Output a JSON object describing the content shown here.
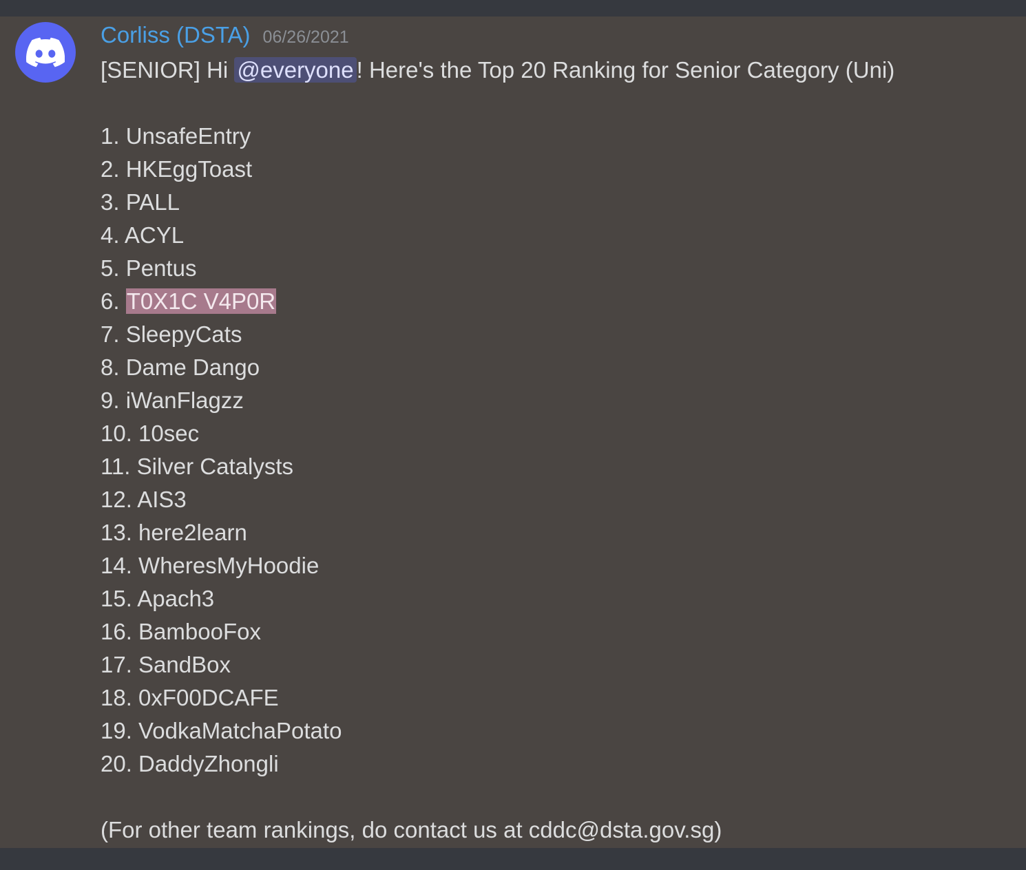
{
  "author": {
    "name": "Corliss (DSTA)",
    "timestamp": "06/26/2021",
    "avatar_icon": "discord-logo-icon",
    "name_color": "#4aa0e6"
  },
  "message": {
    "intro_prefix": "[SENIOR] Hi ",
    "mention": "@everyone",
    "intro_suffix": "! Here's the Top 20 Ranking for Senior Category (Uni)",
    "rankings": [
      {
        "rank": "1.",
        "team": "UnsafeEntry",
        "highlighted": false
      },
      {
        "rank": "2.",
        "team": "HKEggToast",
        "highlighted": false
      },
      {
        "rank": "3.",
        "team": "PALL",
        "highlighted": false
      },
      {
        "rank": "4.",
        "team": "ACYL",
        "highlighted": false
      },
      {
        "rank": "5.",
        "team": "Pentus",
        "highlighted": false
      },
      {
        "rank": "6.",
        "team": "T0X1C V4P0R",
        "highlighted": true
      },
      {
        "rank": "7.",
        "team": "SleepyCats",
        "highlighted": false
      },
      {
        "rank": "8.",
        "team": "Dame Dango",
        "highlighted": false
      },
      {
        "rank": "9.",
        "team": "iWanFlagzz",
        "highlighted": false
      },
      {
        "rank": "10.",
        "team": "10sec",
        "highlighted": false
      },
      {
        "rank": "11.",
        "team": "Silver Catalysts",
        "highlighted": false
      },
      {
        "rank": "12.",
        "team": "AIS3",
        "highlighted": false
      },
      {
        "rank": "13.",
        "team": "here2learn",
        "highlighted": false
      },
      {
        "rank": "14.",
        "team": "WheresMyHoodie",
        "highlighted": false
      },
      {
        "rank": "15.",
        "team": "Apach3",
        "highlighted": false
      },
      {
        "rank": "16.",
        "team": "BambooFox",
        "highlighted": false
      },
      {
        "rank": "17.",
        "team": "SandBox",
        "highlighted": false
      },
      {
        "rank": "18.",
        "team": "0xF00DCAFE",
        "highlighted": false
      },
      {
        "rank": "19.",
        "team": "VodkaMatchaPotato",
        "highlighted": false
      },
      {
        "rank": "20.",
        "team": "DaddyZhongli",
        "highlighted": false
      }
    ],
    "footer": "(For other team rankings, do contact us at cddc@dsta.gov.sg)"
  },
  "colors": {
    "background": "#36393f",
    "message_highlight": "#4a4542",
    "mention_bg": "#4d4f75",
    "selection_bg": "#a77a8c",
    "avatar_bg": "#5865f2"
  }
}
